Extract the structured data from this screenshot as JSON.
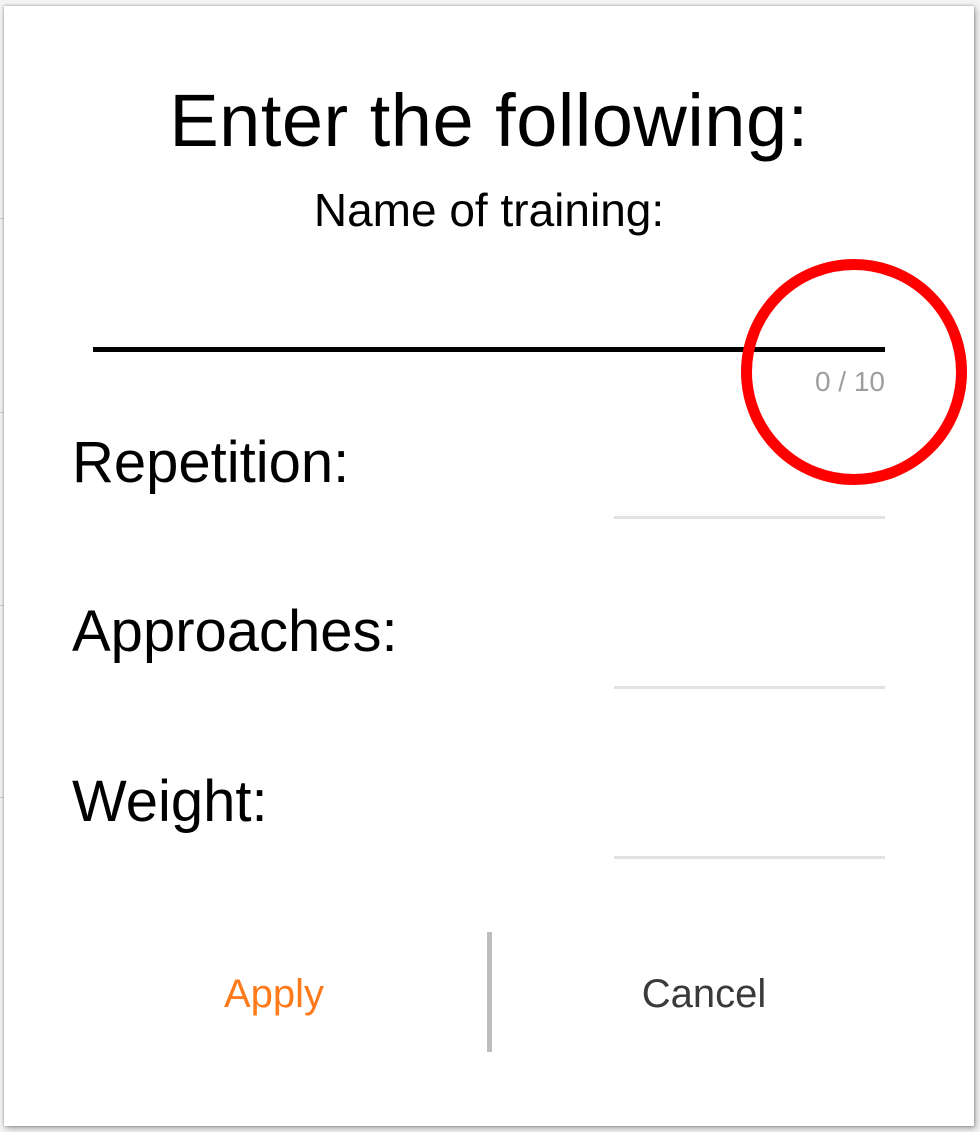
{
  "dialog": {
    "title": "Enter the following:",
    "subtitle": "Name of training:",
    "name_input": {
      "value": "",
      "placeholder": "",
      "counter": "0 / 10",
      "max_length": 10
    },
    "fields": [
      {
        "label": "Repetition:",
        "value": ""
      },
      {
        "label": "Approaches:",
        "value": ""
      },
      {
        "label": "Weight:",
        "value": ""
      }
    ],
    "buttons": {
      "apply": "Apply",
      "cancel": "Cancel"
    }
  },
  "colors": {
    "accent": "#ff7a1a",
    "annotation": "#ff0000",
    "counter": "#9e9e9e",
    "underline_active": "#000000",
    "underline_inactive": "#e2e2e2"
  }
}
